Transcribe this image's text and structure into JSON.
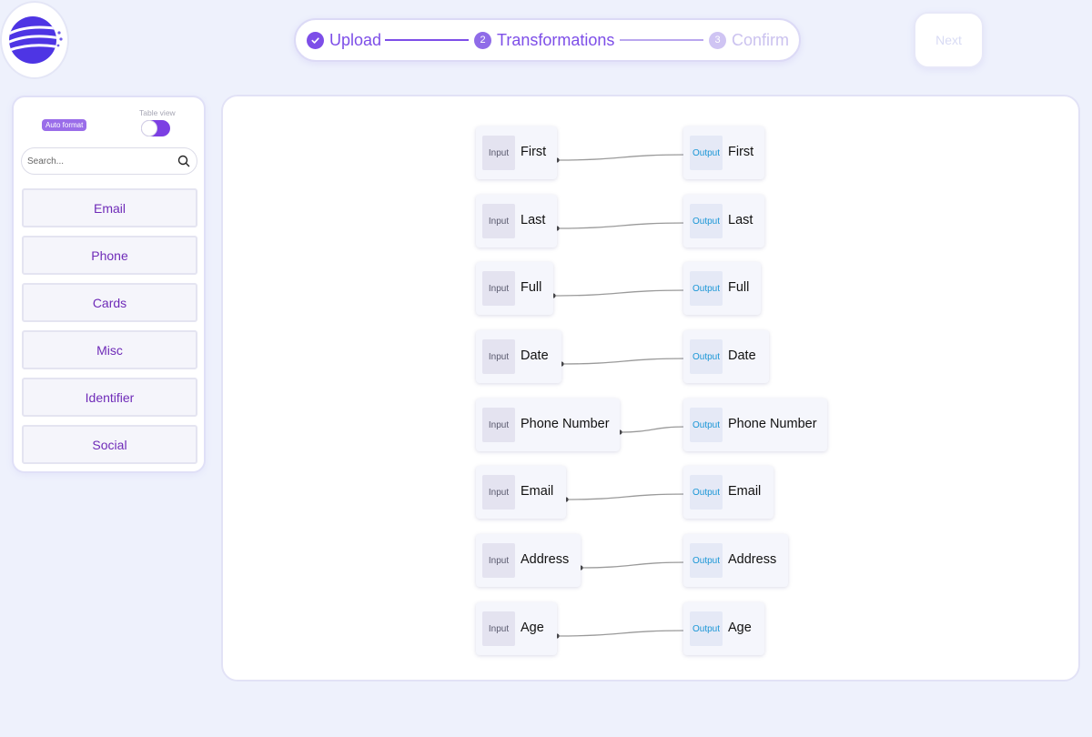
{
  "logo": {
    "icon": "brand-logo-icon",
    "colors": [
      "#4e35e4",
      "#7c4be8"
    ]
  },
  "stepper": {
    "steps": [
      {
        "number": "",
        "label": "Upload",
        "state": "done"
      },
      {
        "number": "2",
        "label": "Transformations",
        "state": "active"
      },
      {
        "number": "3",
        "label": "Confirm",
        "state": "upcoming"
      }
    ]
  },
  "header": {
    "next_label": "Next"
  },
  "sidebar": {
    "auto_format_label": "Auto format",
    "table_view_label": "Table view",
    "table_view_on": false,
    "search_placeholder": "Search...",
    "search_value": "",
    "categories": [
      "Email",
      "Phone",
      "Cards",
      "Misc",
      "Identifier",
      "Social"
    ]
  },
  "mapping": {
    "input_tag": "Input",
    "output_tag": "Output",
    "rows": [
      {
        "input": "First",
        "output": "First"
      },
      {
        "input": "Last",
        "output": "Last"
      },
      {
        "input": "Full",
        "output": "Full"
      },
      {
        "input": "Date",
        "output": "Date"
      },
      {
        "input": "Phone Number",
        "output": "Phone Number"
      },
      {
        "input": "Email",
        "output": "Email"
      },
      {
        "input": "Address",
        "output": "Address"
      },
      {
        "input": "Age",
        "output": "Age"
      }
    ]
  },
  "colors": {
    "accent": "#7d4ee8",
    "category_text": "#6f2bb8",
    "output_tag_text": "#1a96d6",
    "edge": "#9a9a9a"
  }
}
